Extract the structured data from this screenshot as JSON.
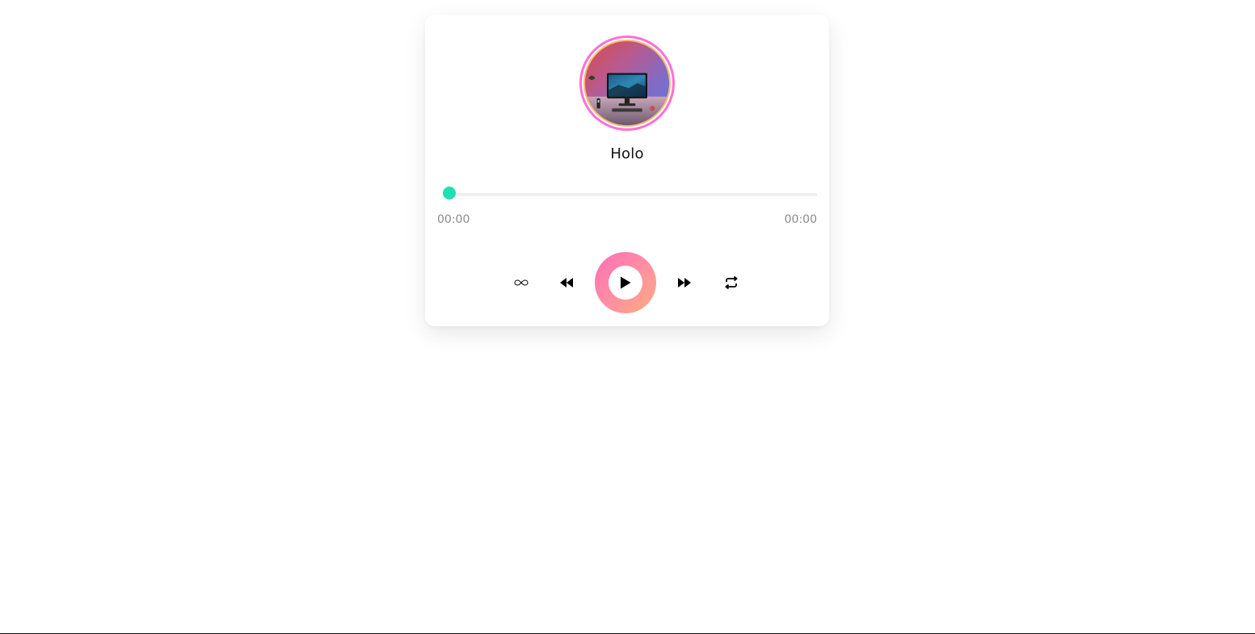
{
  "player": {
    "title": "Holo",
    "current_time": "00:00",
    "total_time": "00:00",
    "progress": 0
  },
  "controls": {
    "infinite_icon": "infinity-icon",
    "prev_icon": "rewind-icon",
    "play_icon": "play-icon",
    "next_icon": "fast-forward-icon",
    "repeat_icon": "repeat-icon"
  },
  "colors": {
    "accent": "#1fe0b2",
    "ring_outer": "#ff6fd8",
    "ring_inner": "#ffb86b",
    "play_gradient_start": "#ff6fb5",
    "play_gradient_end": "#ffad7f"
  }
}
